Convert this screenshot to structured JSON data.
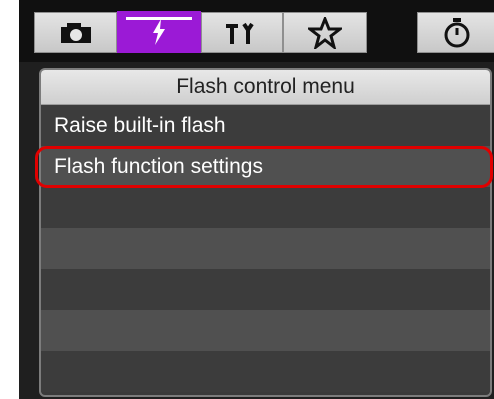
{
  "tabs": [
    {
      "id": "camera",
      "icon": "camera-icon",
      "active": false
    },
    {
      "id": "flash",
      "icon": "flash-icon",
      "active": true
    },
    {
      "id": "setup",
      "icon": "setup-tools-icon",
      "active": false
    },
    {
      "id": "my-menu",
      "icon": "star-outline-icon",
      "active": false
    },
    {
      "id": "timer",
      "icon": "stopwatch-icon",
      "active": false
    }
  ],
  "panel": {
    "title": "Flash control menu",
    "items": [
      {
        "label": "Raise built-in flash"
      },
      {
        "label": "Flash function settings",
        "highlighted": true
      }
    ]
  },
  "colors": {
    "active_tab": "#9b1ad6",
    "highlight": "#e00000"
  }
}
